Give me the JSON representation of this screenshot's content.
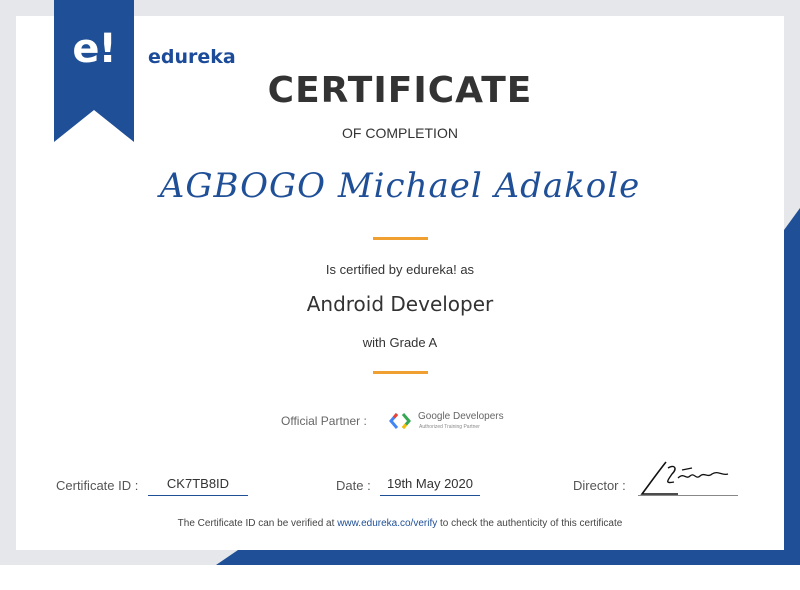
{
  "brand": {
    "mark": "e!",
    "name": "edureka"
  },
  "certificate": {
    "title": "CERTIFICATE",
    "subtitle": "OF COMPLETION",
    "recipient": "AGBOGO Michael Adakole",
    "certified_text": "Is certified by edureka! as",
    "course": "Android Developer",
    "grade": "with Grade A"
  },
  "partner": {
    "label": "Official Partner :",
    "name": "Google Developers",
    "subtitle": "Authorized Training Partner"
  },
  "footer": {
    "id_label": "Certificate ID :",
    "id_value": "CK7TB8ID",
    "date_label": "Date :",
    "date_value": "19th May 2020",
    "director_label": "Director :"
  },
  "verify": {
    "prefix": "The Certificate ID can be verified at",
    "link": "www.edureka.co/verify",
    "suffix": "to check the authenticity of this certificate"
  },
  "colors": {
    "brand_blue": "#1f4f97",
    "accent_orange": "#f0a030",
    "frame_gray": "#e5e7ea"
  }
}
